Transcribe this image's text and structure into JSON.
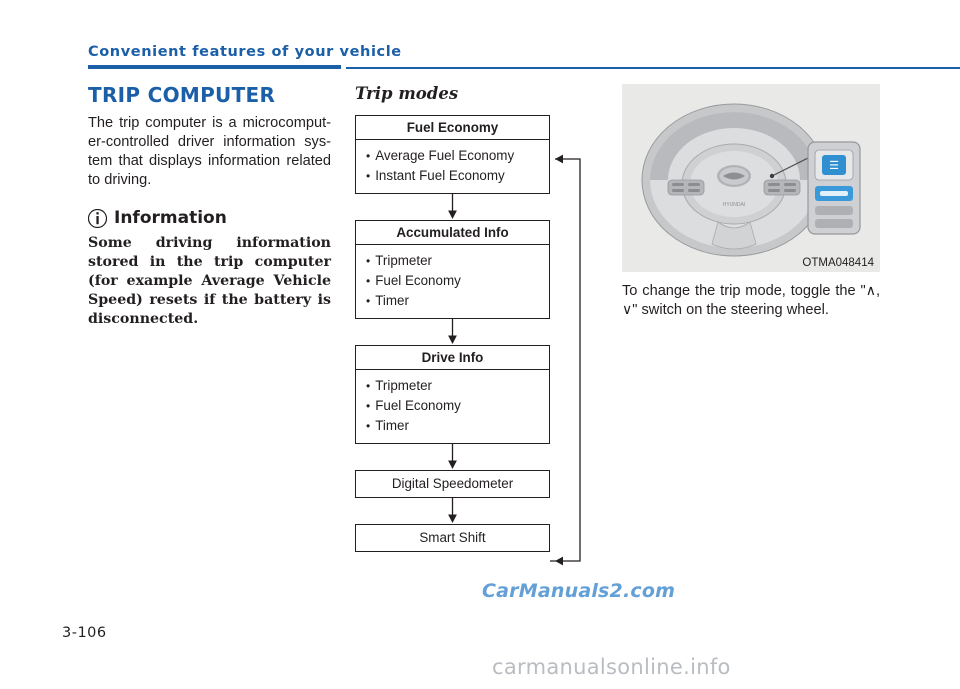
{
  "header": {
    "title": "Convenient features of your vehicle",
    "accent_color": "#1b5fa8"
  },
  "page_number": "3-106",
  "column1": {
    "section_title": "TRIP COMPUTER",
    "intro": "The trip computer is a microcomput-er-controlled driver information sys-tem that displays information related to driving.",
    "info_label": "Information",
    "info_icon": "info-i-icon",
    "info_body": "Some driving information stored in the trip computer (for example Average Vehicle Speed) resets if the battery is disconnected."
  },
  "column2": {
    "sub_title": "Trip modes",
    "flow": [
      {
        "heading": "Fuel Economy",
        "items": [
          "Average Fuel Economy",
          "Instant Fuel Economy"
        ]
      },
      {
        "heading": "Accumulated Info",
        "items": [
          "Tripmeter",
          "Fuel Economy",
          "Timer"
        ]
      },
      {
        "heading": "Drive Info",
        "items": [
          "Tripmeter",
          "Fuel Economy",
          "Timer"
        ]
      },
      {
        "heading": "Digital Speedometer",
        "items": []
      },
      {
        "heading": "Smart Shift",
        "items": []
      }
    ]
  },
  "column3": {
    "photo_caption": "OTMA048414",
    "photo_alt": "steering-wheel-with-trip-mode-switch",
    "body_pre": "To change the trip mode, toggle the \"",
    "glyph_up": "∧",
    "glyph_sep": ",",
    "glyph_down": "∨",
    "body_post": "\" switch on the steering wheel."
  },
  "watermarks": {
    "center": "CarManuals2.com",
    "bottom": "carmanualsonline.info"
  }
}
